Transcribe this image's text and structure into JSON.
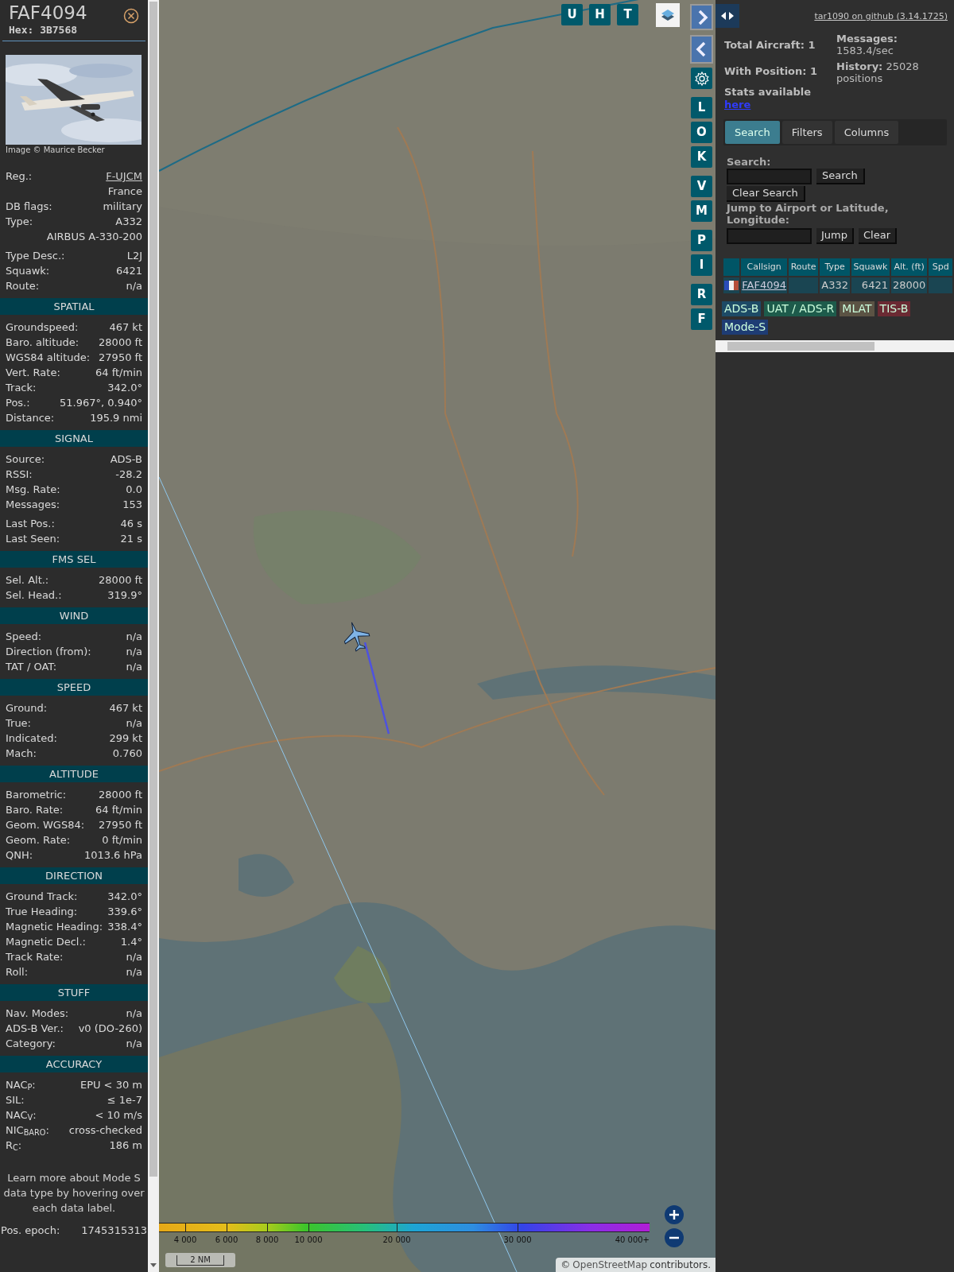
{
  "aircraft_panel": {
    "callsign": "FAF4094",
    "hex": "Hex: 3B7568",
    "photo": {
      "kind": "picture"
    },
    "photo_credit": "Image © Maurice Becker",
    "summary_groups": [
      [
        {
          "kind": "link",
          "label": "Reg.:",
          "value": "F-UJCM"
        },
        {
          "kind": "wrap",
          "value": "France"
        },
        {
          "kind": "text",
          "label": "DB flags:",
          "value": "military"
        },
        {
          "kind": "text",
          "label": "Type:",
          "value": "A332"
        },
        {
          "kind": "wrap",
          "value": "AIRBUS A-330-200"
        }
      ],
      [
        {
          "kind": "text",
          "label": "Type Desc.:",
          "value": "L2J"
        },
        {
          "kind": "text",
          "label": "Squawk:",
          "value": "6421"
        },
        {
          "kind": "text",
          "label": "Route:",
          "value": "n/a"
        }
      ]
    ],
    "sections": [
      {
        "title": "SPATIAL",
        "row_groups": [
          [
            {
              "kind": "text",
              "label": "Groundspeed:",
              "value": "467 kt"
            },
            {
              "kind": "text",
              "label": "Baro. altitude:",
              "value": "28000 ft"
            },
            {
              "kind": "text",
              "label": "WGS84 altitude:",
              "value": "27950 ft"
            },
            {
              "kind": "text",
              "label": "Vert. Rate:",
              "value": "64 ft/min"
            },
            {
              "kind": "text",
              "label": "Track:",
              "value": "342.0°"
            },
            {
              "kind": "text",
              "label": "Pos.:",
              "value": "51.967°, 0.940°"
            },
            {
              "kind": "text",
              "label": "Distance:",
              "value": "195.9 nmi"
            }
          ]
        ]
      },
      {
        "title": "SIGNAL",
        "row_groups": [
          [
            {
              "kind": "text",
              "label": "Source:",
              "value": "ADS-B"
            },
            {
              "kind": "text",
              "label": "RSSI:",
              "value": "-28.2"
            },
            {
              "kind": "text",
              "label": "Msg. Rate:",
              "value": "0.0"
            },
            {
              "kind": "text",
              "label": "Messages:",
              "value": "153"
            }
          ],
          [
            {
              "kind": "text",
              "label": "Last Pos.:",
              "value": "46 s"
            },
            {
              "kind": "text",
              "label": "Last Seen:",
              "value": "21 s"
            }
          ]
        ]
      },
      {
        "title": "FMS SEL",
        "row_groups": [
          [
            {
              "kind": "text",
              "label": "Sel. Alt.:",
              "value": "28000 ft"
            },
            {
              "kind": "text",
              "label": "Sel. Head.:",
              "value": "319.9°"
            }
          ]
        ]
      },
      {
        "title": "WIND",
        "row_groups": [
          [
            {
              "kind": "text",
              "label": "Speed:",
              "value": "n/a"
            },
            {
              "kind": "text",
              "label": "Direction (from):",
              "value": "n/a"
            },
            {
              "kind": "text",
              "label": "TAT / OAT:",
              "value": "n/a"
            }
          ]
        ]
      },
      {
        "title": "SPEED",
        "row_groups": [
          [
            {
              "kind": "text",
              "label": "Ground:",
              "value": "467 kt"
            },
            {
              "kind": "text",
              "label": "True:",
              "value": "n/a"
            },
            {
              "kind": "text",
              "label": "Indicated:",
              "value": "299 kt"
            },
            {
              "kind": "text",
              "label": "Mach:",
              "value": "0.760"
            }
          ]
        ]
      },
      {
        "title": "ALTITUDE",
        "row_groups": [
          [
            {
              "kind": "text",
              "label": "Barometric:",
              "value": "28000 ft"
            },
            {
              "kind": "text",
              "label": "Baro. Rate:",
              "value": "64 ft/min"
            },
            {
              "kind": "text",
              "label": "Geom. WGS84:",
              "value": "27950 ft"
            },
            {
              "kind": "text",
              "label": "Geom. Rate:",
              "value": "0 ft/min"
            },
            {
              "kind": "text",
              "label": "QNH:",
              "value": "1013.6 hPa"
            }
          ]
        ]
      },
      {
        "title": "DIRECTION",
        "row_groups": [
          [
            {
              "kind": "text",
              "label": "Ground Track:",
              "value": "342.0°"
            },
            {
              "kind": "text",
              "label": "True Heading:",
              "value": "339.6°"
            },
            {
              "kind": "text",
              "label": "Magnetic Heading:",
              "value": "338.4°"
            },
            {
              "kind": "text",
              "label": "Magnetic Decl.:",
              "value": "1.4°"
            },
            {
              "kind": "text",
              "label": "Track Rate:",
              "value": "n/a"
            },
            {
              "kind": "text",
              "label": "Roll:",
              "value": "n/a"
            }
          ]
        ]
      },
      {
        "title": "STUFF",
        "row_groups": [
          [
            {
              "kind": "text",
              "label": "Nav. Modes:",
              "value": "n/a"
            },
            {
              "kind": "text",
              "label": "ADS-B Ver.:",
              "value": "v0 (DO-260)"
            },
            {
              "kind": "text",
              "label": "Category:",
              "value": "n/a"
            }
          ]
        ]
      },
      {
        "title": "ACCURACY",
        "row_groups": [
          [
            {
              "kind": "text",
              "label": "NAC$_{P}$:",
              "value": "EPU < 30 m"
            },
            {
              "kind": "text",
              "label": "SIL:",
              "value": "≤ 1e-7"
            },
            {
              "kind": "text",
              "label": "NAC$_{V}$:",
              "value": "< 10 m/s"
            },
            {
              "kind": "text",
              "label": "NIC$_{BARO}$:",
              "value": "cross-checked"
            },
            {
              "kind": "text",
              "label": "R$_{C}$:",
              "value": "186 m"
            }
          ]
        ]
      }
    ],
    "footer_note": "Learn more about Mode S data type by hovering over each data label.",
    "pos_epoch": {
      "label": "Pos. epoch:",
      "value": "1745315313"
    }
  },
  "map": {
    "top_buttons": [
      "U",
      "H",
      "T"
    ],
    "side_button_groups": [
      [
        "L",
        "O",
        "K"
      ],
      [
        "V",
        "M"
      ],
      [
        "P",
        "I"
      ],
      [
        "R",
        "F"
      ]
    ],
    "altitude_legend": [
      "4 000",
      "6 000",
      "8 000",
      "10 000",
      "20 000",
      "30 000",
      "40 000+"
    ],
    "scale": "2 NM",
    "attribution": {
      "prefix": "©",
      "link": "OpenStreetMap",
      "suffix": "contributors."
    }
  },
  "sidebar": {
    "version_link": "tar1090 on github (3.14.1725)",
    "stats_left": [
      "Total Aircraft: 1",
      "With Position: 1"
    ],
    "stats_note": "Stats available",
    "stats_link": "here",
    "stats_right": [
      {
        "label": "Messages:",
        "value": "1583.4/sec"
      },
      {
        "label": "History:",
        "value": "25028 positions"
      }
    ],
    "tabs": [
      {
        "label": "Search",
        "selected": true
      },
      {
        "label": "Filters",
        "selected": false
      },
      {
        "label": "Columns",
        "selected": false
      }
    ],
    "search": {
      "label": "Search:",
      "button": "Search",
      "clear_button": "Clear Search",
      "jump_label": "Jump to Airport or Latitude, Longitude:",
      "jump_button": "Jump",
      "jump_clear_button": "Clear"
    },
    "table": {
      "columns": [
        "Callsign",
        "Route",
        "Type",
        "Squawk",
        "Alt. (ft)",
        "Spd"
      ],
      "rows": [
        {
          "callsign": "FAF4094",
          "type": "A332",
          "squawk": "6421",
          "altitude": "28000"
        }
      ]
    },
    "source_tags": [
      {
        "label": "ADS-B",
        "color": "#1d4a66"
      },
      {
        "label": "UAT / ADS-R",
        "color": "#1d5b4b"
      },
      {
        "label": "MLAT",
        "color": "#5b5344"
      },
      {
        "label": "TIS-B",
        "color": "#6b2a33"
      },
      {
        "label": "Mode-S",
        "color": "#1e3c74"
      }
    ]
  }
}
